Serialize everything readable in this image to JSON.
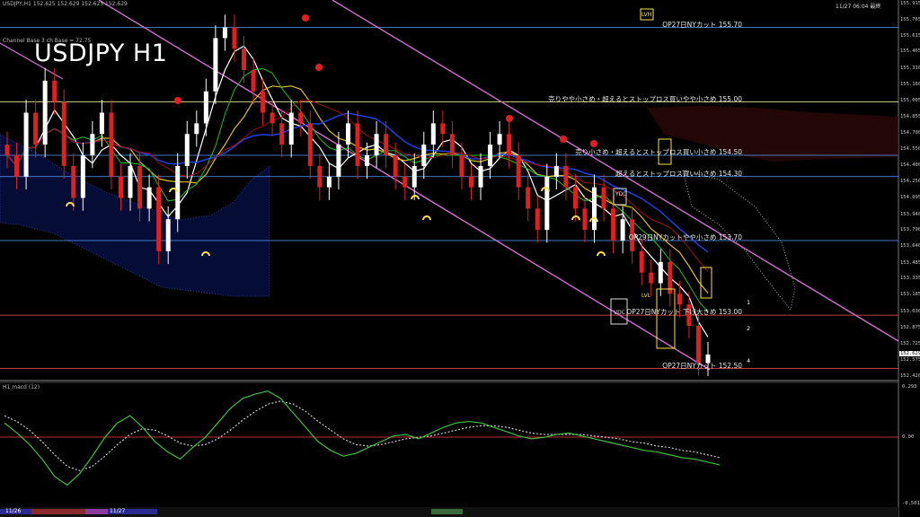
{
  "header": {
    "symbol_line": "USDJPY,H1  152.625 152.629 152.625 152.629",
    "indicator_line": "Channel Base 3 ch Base = 72.75",
    "big_title": "USDJPY H1",
    "top_right": "11/27 06:04 最終"
  },
  "price_axis": {
    "labels": [
      "155.915",
      "155.765",
      "155.615",
      "155.465",
      "155.310",
      "155.160",
      "155.005",
      "154.855",
      "154.700",
      "154.550",
      "154.400",
      "154.250",
      "154.095",
      "153.940",
      "153.790",
      "153.640",
      "153.485",
      "153.335",
      "153.185",
      "153.030",
      "152.875",
      "152.725",
      "152.575",
      "152.420"
    ],
    "current_price": "152.629"
  },
  "level_lines": [
    {
      "text": "売りやや小さめ・超えるとストップロス買いやや小さめ 155.00",
      "price": 155.0,
      "color": "#ffffaa"
    },
    {
      "text": "売り小さめ・超えるとストップロス買い小さめ 154.50",
      "price": 154.5,
      "color": "#5aa0ff"
    },
    {
      "text": "超えるとストップロス買い小さめ 154.30",
      "price": 154.3,
      "color": "#5aa0ff"
    },
    {
      "text": "OP27日NYカット 155.70",
      "price": 155.7,
      "color": "#5aa0ff"
    },
    {
      "text": "OP29日NYカットやや小さめ 153.70",
      "price": 153.7,
      "color": "#5aa0ff"
    },
    {
      "text": "OP27日NYカット 下げ大きめ 153.00",
      "price": 153.0,
      "color": "#ff5555"
    },
    {
      "text": "OP27日NYカット 152.50",
      "price": 152.5,
      "color": "#ff5555"
    }
  ],
  "channel_labels": [
    "1",
    "2",
    "4"
  ],
  "box_labels": {
    "lvh": "LVH",
    "lvl": "LVL",
    "vdc": "VDC",
    "ydc": "YDC"
  },
  "macd": {
    "title": "H1  macd (12)",
    "labels": [
      "0.293",
      "0.00",
      "-0.501"
    ]
  },
  "time_axis": {
    "labels": [
      "11/26",
      "11/27"
    ]
  },
  "chart_data": {
    "type": "line",
    "title": "USDJPY H1",
    "ylim": [
      152.42,
      155.915
    ],
    "candles_hint": "hourly candlesticks (white=up, red=down) from ~154.1 to 152.55",
    "close_path": [
      154.5,
      154.3,
      154.9,
      154.6,
      155.2,
      155.0,
      154.4,
      154.1,
      154.5,
      154.7,
      154.9,
      154.3,
      154.1,
      154.4,
      154.0,
      154.2,
      153.6,
      153.9,
      154.4,
      154.7,
      154.8,
      155.1,
      155.6,
      155.7,
      155.5,
      155.3,
      155.1,
      154.9,
      154.8,
      154.6,
      154.9,
      154.8,
      154.4,
      154.2,
      154.3,
      154.6,
      154.8,
      154.4,
      154.5,
      154.7,
      154.5,
      154.3,
      154.2,
      154.4,
      154.6,
      154.8,
      154.7,
      154.5,
      154.3,
      154.2,
      154.4,
      154.6,
      154.7,
      154.5,
      154.2,
      154.0,
      153.8,
      154.3,
      154.4,
      154.2,
      154.0,
      153.8,
      154.2,
      154.0,
      153.7,
      153.9,
      153.6,
      153.4,
      153.3,
      153.5,
      153.2,
      153.1,
      152.9,
      152.55,
      152.63
    ],
    "macd_path": [
      0.05,
      -0.02,
      -0.1,
      -0.2,
      -0.32,
      -0.38,
      -0.3,
      -0.18,
      -0.05,
      0.05,
      0.1,
      0.02,
      -0.08,
      -0.15,
      -0.2,
      -0.12,
      -0.05,
      0.05,
      0.15,
      0.22,
      0.25,
      0.27,
      0.22,
      0.12,
      0.02,
      -0.08,
      -0.14,
      -0.18,
      -0.16,
      -0.12,
      -0.08,
      -0.04,
      -0.03,
      -0.06,
      -0.02,
      0.02,
      0.05,
      0.06,
      0.05,
      0.02,
      -0.01,
      -0.04,
      -0.06,
      -0.05,
      -0.03,
      -0.02,
      -0.04,
      -0.06,
      -0.08,
      -0.1,
      -0.12,
      -0.14,
      -0.15,
      -0.17,
      -0.19,
      -0.2,
      -0.22,
      -0.24
    ],
    "signal_path": [
      0.1,
      0.06,
      0.0,
      -0.08,
      -0.17,
      -0.25,
      -0.28,
      -0.25,
      -0.18,
      -0.1,
      -0.03,
      0.01,
      0.0,
      -0.04,
      -0.09,
      -0.11,
      -0.1,
      -0.06,
      0.0,
      0.07,
      0.13,
      0.18,
      0.2,
      0.18,
      0.13,
      0.06,
      0.0,
      -0.06,
      -0.1,
      -0.11,
      -0.1,
      -0.08,
      -0.06,
      -0.05,
      -0.04,
      -0.02,
      0.0,
      0.02,
      0.03,
      0.03,
      0.02,
      0.0,
      -0.02,
      -0.03,
      -0.03,
      -0.03,
      -0.03,
      -0.04,
      -0.05,
      -0.06,
      -0.08,
      -0.09,
      -0.11,
      -0.12,
      -0.14,
      -0.15,
      -0.17,
      -0.19
    ]
  }
}
